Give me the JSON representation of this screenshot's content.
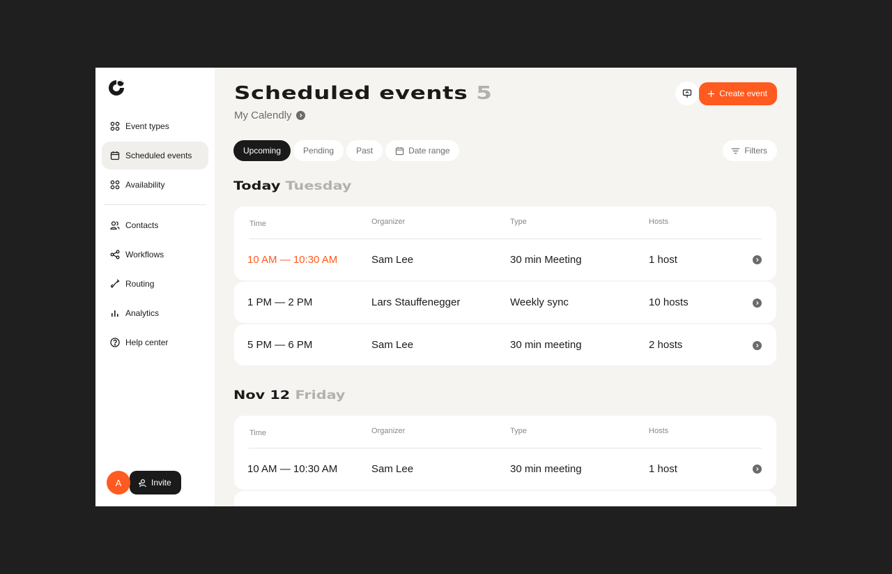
{
  "sidebar": {
    "items": [
      {
        "label": "Event types",
        "icon": "grid-icon"
      },
      {
        "label": "Scheduled events",
        "icon": "calendar-icon"
      },
      {
        "label": "Availability",
        "icon": "grid-icon"
      },
      {
        "label": "Contacts",
        "icon": "users-icon"
      },
      {
        "label": "Workflows",
        "icon": "share-icon"
      },
      {
        "label": "Routing",
        "icon": "routing-icon"
      },
      {
        "label": "Analytics",
        "icon": "bar-chart-icon"
      },
      {
        "label": "Help center",
        "icon": "help-icon"
      }
    ],
    "avatar_initial": "A",
    "invite_label": "Invite"
  },
  "header": {
    "title": "Scheduled events",
    "count": "5",
    "subtitle": "My Calendly",
    "create_label": "Create event"
  },
  "tabs": [
    {
      "label": "Upcoming",
      "active": true
    },
    {
      "label": "Pending"
    },
    {
      "label": "Past"
    },
    {
      "label": "Date range"
    }
  ],
  "filters_label": "Filters",
  "columns": {
    "time": "Time",
    "organizer": "Organizer",
    "type": "Type",
    "hosts": "Hosts"
  },
  "groups": [
    {
      "day": "Today",
      "weekday": "Tuesday",
      "rows": [
        {
          "time": "10 AM — 10:30 AM",
          "organizer": "Sam Lee",
          "type": "30 min Meeting",
          "hosts": "1 host"
        },
        {
          "time": "1 PM — 2 PM",
          "organizer": "Lars Stauffenegger",
          "type": "Weekly sync",
          "hosts": "10 hosts"
        },
        {
          "time": "5 PM — 6 PM",
          "organizer": "Sam Lee",
          "type": "30 min meeting",
          "hosts": "2 hosts"
        }
      ]
    },
    {
      "day": "Nov 12",
      "weekday": "Friday",
      "rows": [
        {
          "time": "10 AM — 10:30 AM",
          "organizer": "Sam Lee",
          "type": "30 min meeting",
          "hosts": "1 host"
        }
      ]
    }
  ],
  "colors": {
    "accent": "#ff5a1f",
    "dark": "#1a1a1a",
    "muted": "#b3b1ab",
    "background": "#f5f4f0"
  }
}
